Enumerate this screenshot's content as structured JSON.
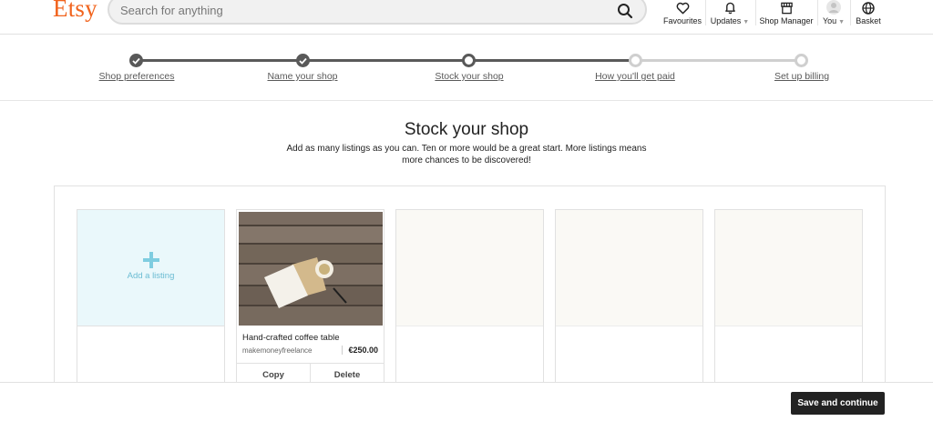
{
  "header": {
    "logo": "Etsy",
    "search_placeholder": "Search for anything",
    "nav": {
      "favourites": "Favourites",
      "updates": "Updates",
      "shop_manager": "Shop Manager",
      "you": "You",
      "basket": "Basket"
    }
  },
  "progress": {
    "steps": [
      {
        "label": "Shop preferences",
        "state": "done"
      },
      {
        "label": "Name your shop",
        "state": "done"
      },
      {
        "label": "Stock your shop",
        "state": "current"
      },
      {
        "label": "How you'll get paid",
        "state": "todo"
      },
      {
        "label": "Set up billing",
        "state": "todo"
      }
    ]
  },
  "main": {
    "title": "Stock your shop",
    "subtitle_line1": "Add as many listings as you can. Ten or more would be a great start. More listings means",
    "subtitle_line2": "more chances to be discovered!",
    "add_listing_label": "Add a listing",
    "listing": {
      "title": "Hand-crafted coffee table",
      "shop": "makemoneyfreelance",
      "price": "€250.00",
      "copy_label": "Copy",
      "delete_label": "Delete"
    }
  },
  "footer": {
    "save_label": "Save and continue"
  },
  "colors": {
    "brand": "#f1641e",
    "add_tint": "#eaf8fb",
    "add_accent": "#7fcde0",
    "primary_button": "#222222"
  }
}
